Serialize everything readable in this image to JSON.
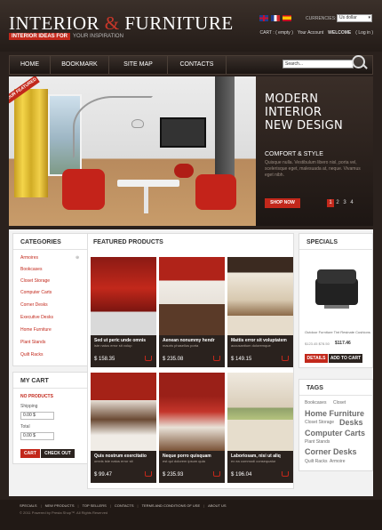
{
  "header": {
    "logo_part1": "INTERIOR",
    "logo_amp": "&",
    "logo_part2": "FURNITURE",
    "tagline_highlight": "INTERIOR IDEAS FOR",
    "tagline_rest": "YOUR INSPIRATION",
    "currencies_label": "CURRENCIES:",
    "currency_value": "Us dollar",
    "cart_link": "CART : ( empty )",
    "account_link": "Your Account",
    "welcome": "WELCOME",
    "login": "( Log in )"
  },
  "nav": {
    "items": [
      "HOME",
      "BOOKMARK",
      "SITE MAP",
      "CONTACTS"
    ],
    "search_placeholder": "Search..."
  },
  "slider": {
    "ribbon": "OUR FEATURED",
    "title": "MODERN\nINTERIOR\nNEW DESIGN",
    "subtitle": "COMFORT & STYLE",
    "description": "Quisque nulla. Vestibulum libero nisl, porta vel, scelerisque eget, malesuada at, neque. Vivamus eget nibh.",
    "button": "SHOP NOW",
    "pages": [
      "1",
      "2",
      "3",
      "4"
    ],
    "active_page": "1"
  },
  "categories": {
    "title": "CATEGORIES",
    "items": [
      "Armoires",
      "Bookcases",
      "Closet Storage",
      "Computer Carts",
      "Corner Desks",
      "Executive Desks",
      "Home Furniture",
      "Plant Stands",
      "Quilt Racks"
    ]
  },
  "cart": {
    "title": "MY CART",
    "empty": "NO PRODUCTS",
    "shipping_label": "Shipping",
    "shipping_value": "0.00 $",
    "total_label": "Total",
    "total_value": "0.00 $",
    "cart_button": "CART",
    "checkout_button": "CHECK OUT"
  },
  "featured": {
    "title": "FEATURED PRODUCTS",
    "products": [
      {
        "name": "Sed ut peric unde omnis",
        "desc": "iste natus error sit volup",
        "price": "$ 158.35"
      },
      {
        "name": "Aenean nonummy hendr",
        "desc": "mauris phasellus porta",
        "price": "$ 235.08"
      },
      {
        "name": "Mattis error sit voluptatem",
        "desc": "accusantium doloremque",
        "price": "$ 149.15"
      },
      {
        "name": "Quis nostrum exercitatio",
        "desc": "omnis iste natus error sit",
        "price": "$ 99.47"
      },
      {
        "name": "Neque porro quisquam",
        "desc": "est qui dolorem ipsum quia",
        "price": "$ 235.93"
      },
      {
        "name": "Laboriosam, nisi ut aliq",
        "desc": "ex ea commodi consequatur",
        "price": "$ 196.04"
      }
    ]
  },
  "specials": {
    "title": "SPECIALS",
    "product_name": "Outdoor Furniture Tint Resinate Cushions",
    "old_price": "$123.45 $78.50",
    "new_price": "$117.46",
    "details_button": "DETAILS",
    "addtocart_button": "ADD TO CART"
  },
  "tags": {
    "title": "TAGS",
    "items": [
      "Bookcases",
      "Closet",
      "Home Furniture",
      "Closet Storage",
      "Desks",
      "Computer Carts",
      "Plant Stands",
      "Corner Desks",
      "Quilt Racks",
      "Armoire"
    ]
  },
  "footer": {
    "links": [
      "SPECIALS",
      "NEW PRODUCTS",
      "TOP SELLERS",
      "CONTACTS",
      "TERMS AND CONDITIONS OF USE",
      "ABOUT US"
    ],
    "copyright": "© 2011 Powered by Presta Shop™. All Rights Reserved"
  },
  "colors": {
    "accent": "#c2281b",
    "dark": "#2a211d",
    "panel": "#f2f2f2"
  }
}
